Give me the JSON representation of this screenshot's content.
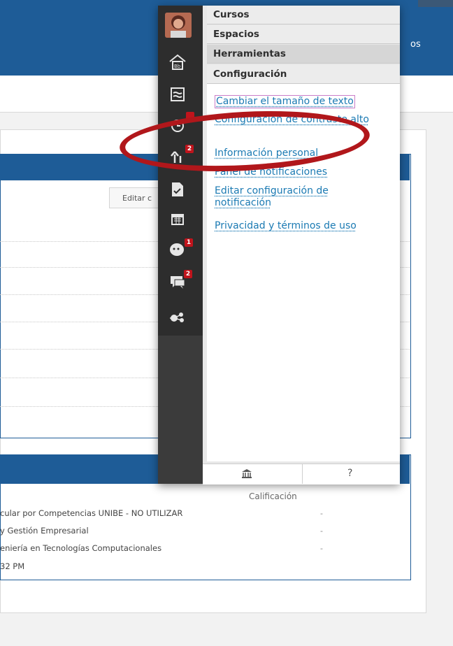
{
  "header": {
    "nav_fragment": "os"
  },
  "page": {
    "edit_button": "Editar c",
    "grade_header": "Calificación",
    "courses": [
      {
        "name": "cular por Competencias UNIBE - NO UTILIZAR",
        "grade": "-"
      },
      {
        "name": "y Gestión Empresarial",
        "grade": "-"
      },
      {
        "name": "eniería en Tecnologías Computacionales",
        "grade": "-"
      },
      {
        "name": "32 PM",
        "grade": ""
      }
    ]
  },
  "menu": {
    "tabs": [
      {
        "label": "Cursos"
      },
      {
        "label": "Espacios"
      },
      {
        "label": "Herramientas"
      },
      {
        "label": "Configuración"
      }
    ],
    "settings_links": [
      {
        "label": "Cambiar el tamaño de texto"
      },
      {
        "label": "Configuración de contraste alto"
      },
      {
        "label": "Información personal"
      },
      {
        "label": "Panel de notificaciones"
      },
      {
        "label": "Editar configuración de notificación"
      },
      {
        "label": "Privacidad y términos de uso"
      }
    ],
    "side_icons": [
      {
        "name": "blackboard-home-icon",
        "badge": ""
      },
      {
        "name": "activity-stream-icon",
        "badge": ""
      },
      {
        "name": "calendar-history-icon",
        "badge": ""
      },
      {
        "name": "updates-icon",
        "badge": "2"
      },
      {
        "name": "tasks-icon",
        "badge": ""
      },
      {
        "name": "calendar-icon",
        "badge": ""
      },
      {
        "name": "messages-icon",
        "badge": "1"
      },
      {
        "name": "discussions-icon",
        "badge": "2"
      },
      {
        "name": "connections-icon",
        "badge": ""
      }
    ],
    "footer": {
      "help_label": "?"
    }
  },
  "colors": {
    "brand_blue": "#1e5c97",
    "link_blue": "#1b7ab3",
    "badge_red": "#c0141c",
    "annotation_red": "#b1171b"
  }
}
